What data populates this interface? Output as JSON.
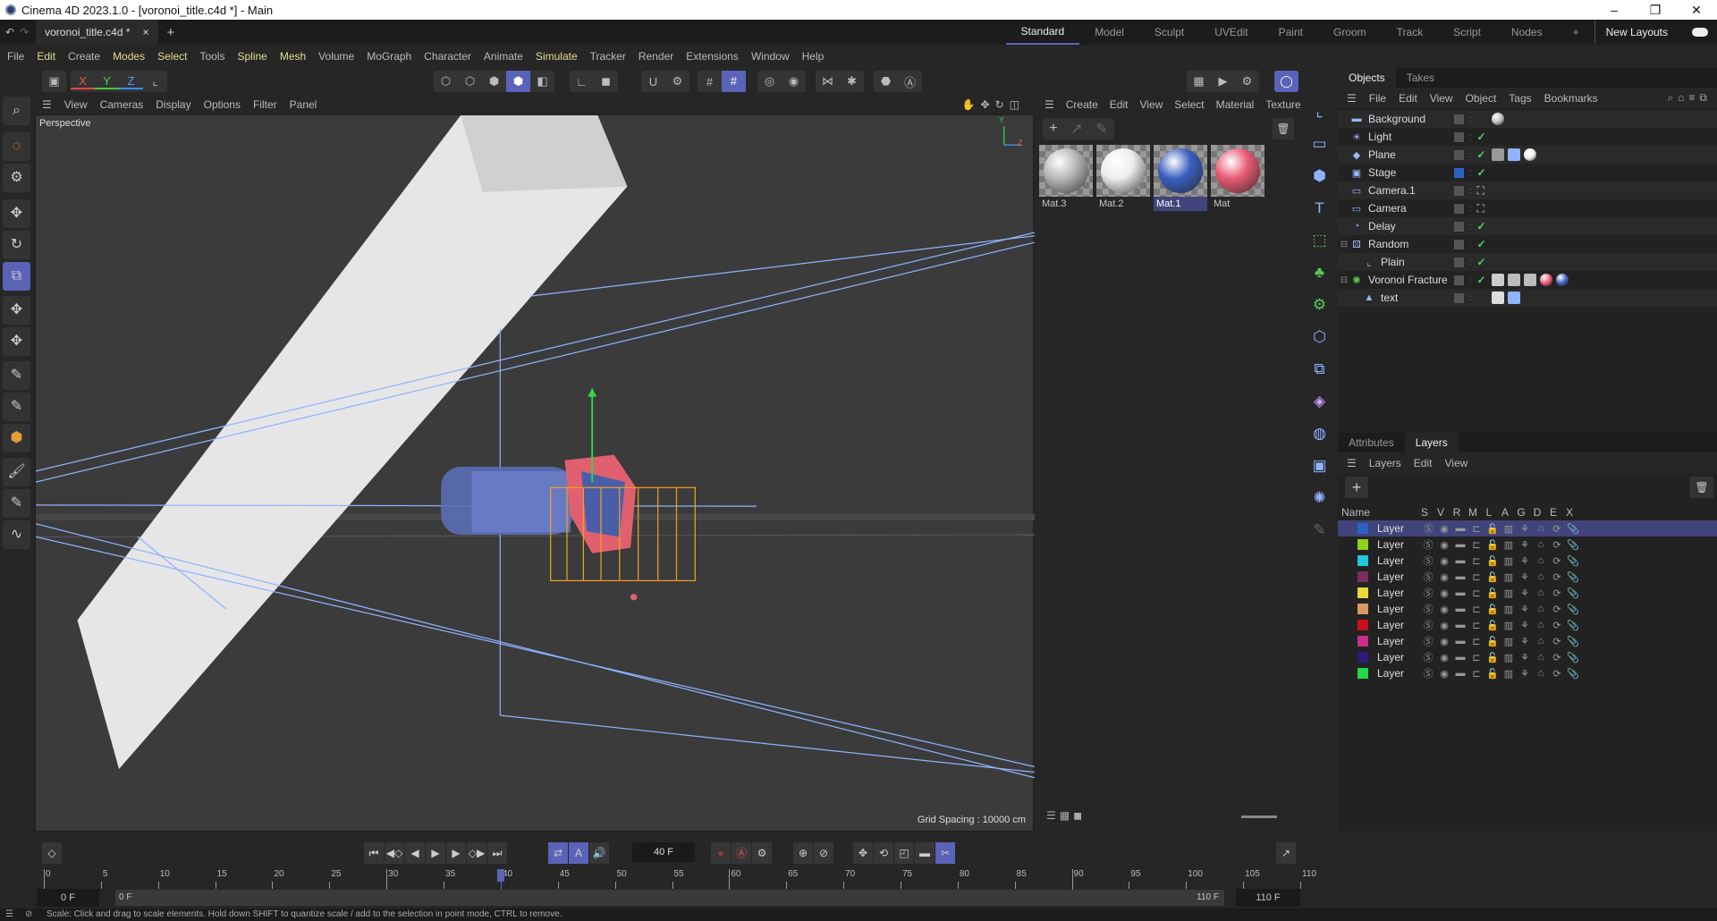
{
  "window": {
    "title": "Cinema 4D 2023.1.0 - [voronoi_title.c4d *] - Main",
    "controls": [
      "–",
      "❐",
      "✕"
    ]
  },
  "doc_tab": {
    "label": "voronoi_title.c4d *",
    "close": "×",
    "add": "+"
  },
  "layouts": {
    "items": [
      "Standard",
      "Model",
      "Sculpt",
      "UVEdit",
      "Paint",
      "Groom",
      "Track",
      "Script",
      "Nodes"
    ],
    "active": "Standard",
    "add": "+",
    "new_layouts": "New Layouts"
  },
  "menu": [
    "File",
    "Edit",
    "Create",
    "Modes",
    "Select",
    "Tools",
    "Spline",
    "Mesh",
    "Volume",
    "MoGraph",
    "Character",
    "Animate",
    "Simulate",
    "Tracker",
    "Render",
    "Extensions",
    "Window",
    "Help"
  ],
  "toolbar": {
    "axes": [
      "X",
      "Y",
      "Z"
    ]
  },
  "viewport": {
    "menu": [
      "View",
      "Cameras",
      "Display",
      "Options",
      "Filter",
      "Panel"
    ],
    "label": "Perspective",
    "grid_spacing": "Grid Spacing : 10000 cm",
    "axis_y": "Y",
    "axis_z": "Z"
  },
  "materials": {
    "menu": [
      "Create",
      "Edit",
      "View",
      "Select",
      "Material",
      "Texture"
    ],
    "items": [
      {
        "name": "Mat.3",
        "color": "#b8b8b8"
      },
      {
        "name": "Mat.2",
        "color": "#ececec"
      },
      {
        "name": "Mat.1",
        "color": "#3a5fc0",
        "selected": true
      },
      {
        "name": "Mat",
        "color": "#e85a72"
      }
    ]
  },
  "objects": {
    "tabs": [
      "Objects",
      "Takes"
    ],
    "menu": [
      "File",
      "Edit",
      "View",
      "Object",
      "Tags",
      "Bookmarks"
    ],
    "items": [
      {
        "name": "Background",
        "icon": "background-icon",
        "check": false
      },
      {
        "name": "Light",
        "icon": "light-icon",
        "check": true
      },
      {
        "name": "Plane",
        "icon": "plane-icon",
        "check": true
      },
      {
        "name": "Stage",
        "icon": "stage-icon",
        "check": true
      },
      {
        "name": "Camera.1",
        "icon": "camera-icon",
        "check": false
      },
      {
        "name": "Camera",
        "icon": "camera-icon",
        "check": false
      },
      {
        "name": "Delay",
        "icon": "delay-icon",
        "check": true
      },
      {
        "name": "Random",
        "icon": "random-icon",
        "check": true
      },
      {
        "name": "Plain",
        "icon": "plain-effector-icon",
        "check": true
      },
      {
        "name": "Voronoi Fracture",
        "icon": "voronoi-icon",
        "check": true
      },
      {
        "name": "text",
        "icon": "text-icon",
        "check": false
      }
    ]
  },
  "layers": {
    "tabs": [
      "Attributes",
      "Layers"
    ],
    "menu": [
      "Layers",
      "Edit",
      "View"
    ],
    "columns": [
      "Name",
      "S",
      "V",
      "R",
      "M",
      "L",
      "A",
      "G",
      "D",
      "E",
      "X"
    ],
    "items": [
      {
        "name": "Layer",
        "color": "#2f62c8",
        "selected": true
      },
      {
        "name": "Layer",
        "color": "#8fd21a"
      },
      {
        "name": "Layer",
        "color": "#22c8d8"
      },
      {
        "name": "Layer",
        "color": "#7a2f5e"
      },
      {
        "name": "Layer",
        "color": "#e8d83a"
      },
      {
        "name": "Layer",
        "color": "#d89a5e"
      },
      {
        "name": "Layer",
        "color": "#c8101a"
      },
      {
        "name": "Layer",
        "color": "#c82f8e"
      },
      {
        "name": "Layer",
        "color": "#2f1a7a"
      },
      {
        "name": "Layer",
        "color": "#22d84a"
      }
    ]
  },
  "timeline": {
    "current_frame": "40 F",
    "current": 40,
    "ticks": [
      "0",
      "5",
      "10",
      "15",
      "20",
      "25",
      "30",
      "35",
      "40",
      "45",
      "50",
      "55",
      "60",
      "65",
      "70",
      "75",
      "80",
      "85",
      "90",
      "95",
      "100",
      "105",
      "110"
    ],
    "start": "0 F",
    "range_start": "0 F",
    "range_end": "110 F",
    "end": "110 F"
  },
  "status": "Scale: Click and drag to scale elements. Hold down SHIFT to quantize scale / add to the selection in point mode, CTRL to remove.",
  "accent": "#5a63b8"
}
